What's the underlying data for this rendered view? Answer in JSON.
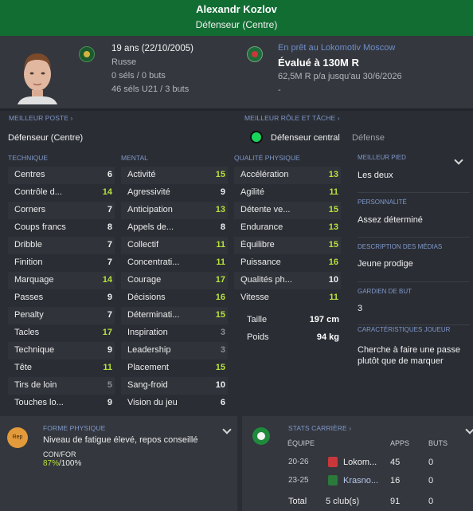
{
  "header": {
    "name": "Alexandr Kozlov",
    "position": "Défenseur (Centre)"
  },
  "info": {
    "age_dob": "19 ans (22/10/2005)",
    "nationality": "Russe",
    "caps": "0 séls / 0 buts",
    "u21": "46 séls U21 / 3 buts",
    "loan": "En prêt au Lokomotiv Moscow",
    "value": "Évalué à 130M R",
    "wage": "62,5M R p/a jusqu'au 30/6/2026",
    "dash": "-"
  },
  "best_position": {
    "title": "MEILLEUR POSTE",
    "value": "Défenseur (Centre)"
  },
  "best_role": {
    "title": "MEILLEUR RÔLE ET TÂCHE",
    "role": "Défenseur central",
    "duty": "Défense"
  },
  "colors": {
    "green": "#b8e23c",
    "white": "#f0f0f0",
    "grey": "#8b8e94"
  },
  "technical": {
    "title": "TECHNIQUE",
    "items": [
      {
        "label": "Centres",
        "value": "6",
        "tone": "white"
      },
      {
        "label": "Contrôle d...",
        "value": "14",
        "tone": "green"
      },
      {
        "label": "Corners",
        "value": "7",
        "tone": "white"
      },
      {
        "label": "Coups francs",
        "value": "8",
        "tone": "white"
      },
      {
        "label": "Dribble",
        "value": "7",
        "tone": "white"
      },
      {
        "label": "Finition",
        "value": "7",
        "tone": "white"
      },
      {
        "label": "Marquage",
        "value": "14",
        "tone": "green"
      },
      {
        "label": "Passes",
        "value": "9",
        "tone": "white"
      },
      {
        "label": "Penalty",
        "value": "7",
        "tone": "white"
      },
      {
        "label": "Tacles",
        "value": "17",
        "tone": "green"
      },
      {
        "label": "Technique",
        "value": "9",
        "tone": "white"
      },
      {
        "label": "Tête",
        "value": "11",
        "tone": "green"
      },
      {
        "label": "Tirs de loin",
        "value": "5",
        "tone": "grey"
      },
      {
        "label": "Touches lo...",
        "value": "9",
        "tone": "white"
      }
    ]
  },
  "mental": {
    "title": "MENTAL",
    "items": [
      {
        "label": "Activité",
        "value": "15",
        "tone": "green"
      },
      {
        "label": "Agressivité",
        "value": "9",
        "tone": "white"
      },
      {
        "label": "Anticipation",
        "value": "13",
        "tone": "green"
      },
      {
        "label": "Appels de...",
        "value": "8",
        "tone": "white"
      },
      {
        "label": "Collectif",
        "value": "11",
        "tone": "green"
      },
      {
        "label": "Concentrati...",
        "value": "11",
        "tone": "green"
      },
      {
        "label": "Courage",
        "value": "17",
        "tone": "green"
      },
      {
        "label": "Décisions",
        "value": "16",
        "tone": "green"
      },
      {
        "label": "Déterminati...",
        "value": "15",
        "tone": "green"
      },
      {
        "label": "Inspiration",
        "value": "3",
        "tone": "grey"
      },
      {
        "label": "Leadership",
        "value": "3",
        "tone": "grey"
      },
      {
        "label": "Placement",
        "value": "15",
        "tone": "green"
      },
      {
        "label": "Sang-froid",
        "value": "10",
        "tone": "white"
      },
      {
        "label": "Vision du jeu",
        "value": "6",
        "tone": "white"
      }
    ]
  },
  "physical": {
    "title": "QUALITÉ PHYSIQUE",
    "items": [
      {
        "label": "Accélération",
        "value": "13",
        "tone": "green"
      },
      {
        "label": "Agilité",
        "value": "11",
        "tone": "green"
      },
      {
        "label": "Détente ve...",
        "value": "15",
        "tone": "green"
      },
      {
        "label": "Endurance",
        "value": "13",
        "tone": "green"
      },
      {
        "label": "Équilibre",
        "value": "15",
        "tone": "green"
      },
      {
        "label": "Puissance",
        "value": "16",
        "tone": "green"
      },
      {
        "label": "Qualités ph...",
        "value": "10",
        "tone": "white"
      },
      {
        "label": "Vitesse",
        "value": "11",
        "tone": "green"
      }
    ],
    "height_label": "Taille",
    "height": "197 cm",
    "weight_label": "Poids",
    "weight": "94 kg"
  },
  "side": {
    "foot_title": "MEILLEUR PIED",
    "foot": "Les deux",
    "personality_title": "PERSONNALITÉ",
    "personality": "Assez déterminé",
    "media_title": "DESCRIPTION DES MÉDIAS",
    "media": "Jeune prodige",
    "gk_title": "GARDIEN DE BUT",
    "gk": "3",
    "traits_title": "CARACTÉRISTIQUES JOUEUR",
    "traits": "Cherche à faire une passe plutôt que de marquer"
  },
  "fitness": {
    "icon_label": "Rep",
    "title": "FORME PHYSIQUE",
    "status": "Niveau de fatigue élevé, repos conseillé",
    "cond_label": "CON/FOR",
    "cond_value": "87%",
    "cond_rest": "/100%"
  },
  "career": {
    "title": "STATS CARRIÈRE",
    "col_team": "ÉQUIPE",
    "col_apps": "APPS",
    "col_goals": "BUTS",
    "rows": [
      {
        "season": "20-26",
        "team": "Lokom...",
        "apps": "45",
        "goals": "0"
      },
      {
        "season": "23-25",
        "team": "Krasno...",
        "apps": "16",
        "goals": "0"
      }
    ],
    "total_label": "Total",
    "total_clubs": "5 club(s)",
    "total_apps": "91",
    "total_goals": "0"
  }
}
